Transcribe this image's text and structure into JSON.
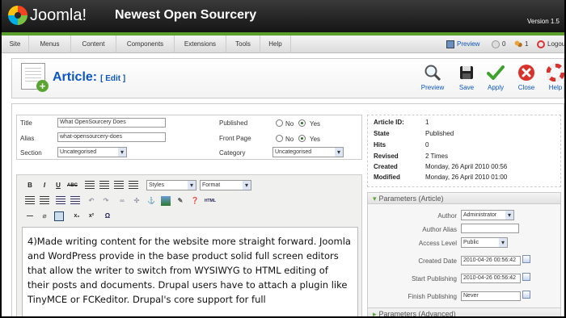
{
  "header": {
    "logo_text": "Joomla!",
    "site_name": "Newest Open Sourcery",
    "version": "Version 1.5"
  },
  "menu": {
    "items": [
      "Site",
      "Menus",
      "Content",
      "Components",
      "Extensions",
      "Tools",
      "Help"
    ]
  },
  "status": {
    "preview": "Preview",
    "messages": "0",
    "users": "1",
    "logout": "Logout"
  },
  "toolbar": {
    "title": "Article:",
    "title_edit": "[ Edit ]",
    "buttons": [
      "Preview",
      "Save",
      "Apply",
      "Close",
      "Help"
    ]
  },
  "form": {
    "title_label": "Title",
    "title_value": "What OpenSourcery Does",
    "alias_label": "Alias",
    "alias_value": "what-opensourcery-does",
    "section_label": "Section",
    "section_value": "Uncategorised",
    "published_label": "Published",
    "frontpage_label": "Front Page",
    "no_label": "No",
    "yes_label": "Yes",
    "category_label": "Category",
    "category_value": "Uncategorised"
  },
  "editor": {
    "styles": "Styles",
    "format": "Format",
    "body": "4)Made writing content for the website  more straight forward. Joomla and WordPress provide  in the base product solid full screen editors that allow the writer to switch from WYSIWYG to HTML editing of their posts and documents. Drupal users have to attach a plugin like TinyMCE or FCKeditor. Drupal's core support for full"
  },
  "info": {
    "rows": [
      {
        "key": "Article ID:",
        "value": "1"
      },
      {
        "key": "State",
        "value": "Published"
      },
      {
        "key": "Hits",
        "value": "0"
      },
      {
        "key": "Revised",
        "value": "2 Times"
      },
      {
        "key": "Created",
        "value": "Monday, 26 April 2010 00:56"
      },
      {
        "key": "Modified",
        "value": "Monday, 26 April 2010 01:00"
      }
    ]
  },
  "params": {
    "title": "Parameters (Article)",
    "author_label": "Author",
    "author_value": "Administrator",
    "alias_label": "Author Alias",
    "access_label": "Access Level",
    "access_value": "Public",
    "created_label": "Created Date",
    "created_value": "2010-04-26 00:56:42",
    "start_label": "Start Publishing",
    "start_value": "2010-04-26 00:56:42",
    "finish_label": "Finish Publishing",
    "finish_value": "Never",
    "advanced_title": "Parameters (Advanced)"
  }
}
